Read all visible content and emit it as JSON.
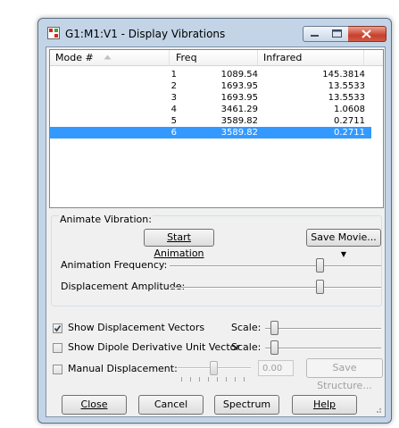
{
  "window": {
    "title": "G1:M1:V1 - Display Vibrations"
  },
  "list": {
    "columns": [
      "Mode #",
      "Freq",
      "Infrared"
    ],
    "sort_indicator": "sort-ascending-icon",
    "rows": [
      {
        "mode": "1",
        "freq": "1089.54",
        "infrared": "145.3814"
      },
      {
        "mode": "2",
        "freq": "1693.95",
        "infrared": "13.5533"
      },
      {
        "mode": "3",
        "freq": "1693.95",
        "infrared": "13.5533"
      },
      {
        "mode": "4",
        "freq": "3461.29",
        "infrared": "1.0608"
      },
      {
        "mode": "5",
        "freq": "3589.82",
        "infrared": "0.2711"
      },
      {
        "mode": "6",
        "freq": "3589.82",
        "infrared": "0.2711"
      }
    ],
    "selected_row": 5
  },
  "animate": {
    "group_label": "Animate Vibration:",
    "start_label": "Start Animation",
    "save_movie_label": "Save Movie...",
    "frequency_label": "Animation Frequency:",
    "amplitude_label": "Displacement Amplitude:",
    "frequency_level": 0.72,
    "amplitude_level": 0.72
  },
  "options": {
    "show_vectors_label": "Show Displacement Vectors",
    "show_vectors_checked": true,
    "show_dipole_label": "Show Dipole Derivative Unit Vector",
    "show_dipole_checked": false,
    "scale_label": "Scale:",
    "vectors_scale_level": 0.05,
    "dipole_scale_level": 0.05,
    "manual_label": "Manual Displacement:",
    "manual_checked": false,
    "manual_value": "0.00",
    "save_structure_label": "Save Structure..."
  },
  "buttons": {
    "close": "Close",
    "cancel": "Cancel",
    "spectrum": "Spectrum",
    "help": "Help"
  },
  "colors": {
    "selection": "#3399ff",
    "frame": "#c3d4e7"
  }
}
